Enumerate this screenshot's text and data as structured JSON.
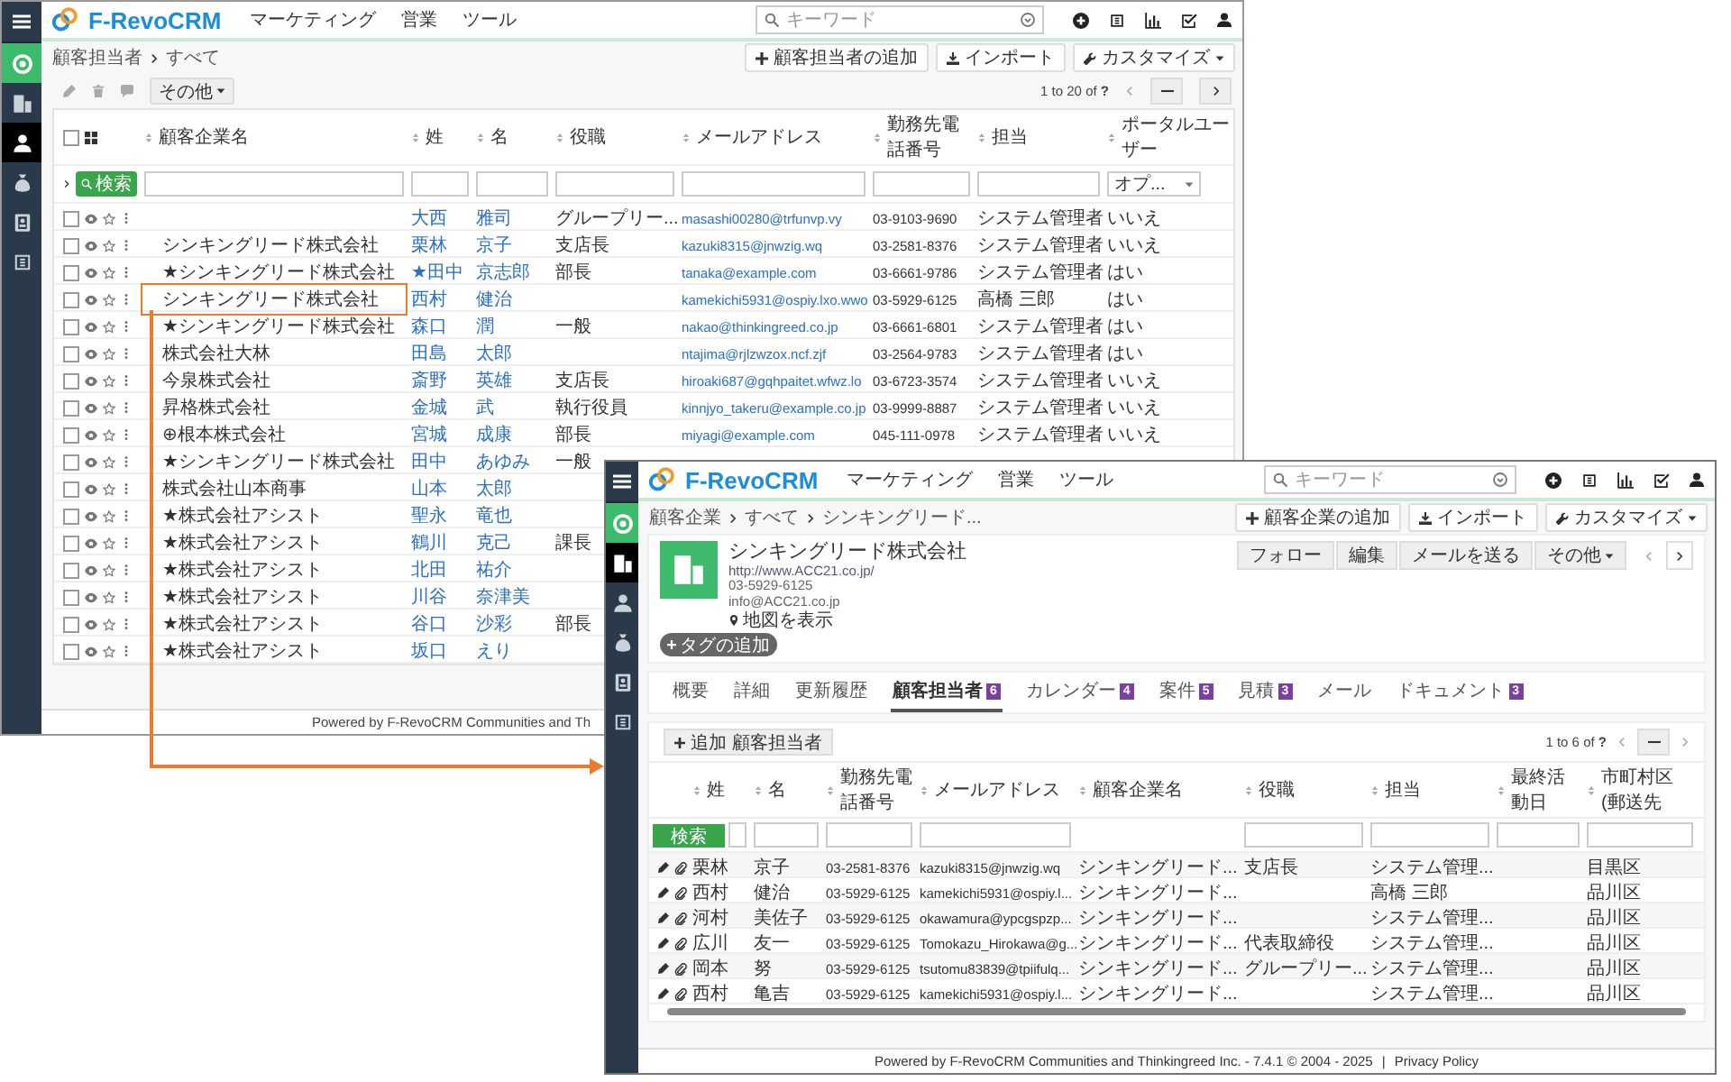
{
  "back_window": {
    "header": {
      "logo": "F-RevoCRM",
      "menus": [
        "マーケティング",
        "営業",
        "ツール"
      ],
      "search_placeholder": "キーワード"
    },
    "sidebar": [
      {
        "selected": false
      },
      {
        "selected": false
      },
      {
        "selected": true
      },
      {
        "selected": false
      },
      {
        "selected": false
      },
      {
        "selected": false
      }
    ],
    "breadcrumb": [
      "顧客担当者",
      "すべて"
    ],
    "actions": [
      "顧客担当者の追加",
      "インポート",
      "カスタマイズ"
    ],
    "toolbar": {
      "more": "その他",
      "pagination": "1 to 20  of **?**"
    },
    "table": {
      "select_all_checked": false,
      "columns": [
        "顧客企業名",
        "姓",
        "名",
        "役職",
        "メールアドレス",
        "勤務先電話番号",
        "担当",
        "ポータルユーザー"
      ],
      "search_button": "検索",
      "portal_filter": "オプ...",
      "rows": [
        {
          "checked": false,
          "highlighted": false,
          "last": "大西",
          "first": "雅司",
          "title": "グループリー...",
          "email": "masashi00280@trfunvp.vy",
          "phone": "03-9103-9690",
          "owner": "システム管理者",
          "portal": "いいえ"
        },
        {
          "checked": false,
          "highlighted": false,
          "company": "シンキングリード株式会社",
          "last": "栗林",
          "first": "京子",
          "title": "支店長",
          "email": "kazuki8315@jnwzig.wq",
          "phone": "03-2581-8376",
          "owner": "システム管理者",
          "portal": "いいえ"
        },
        {
          "checked": false,
          "highlighted": false,
          "company": "★シンキングリード株式会社",
          "last": "★田中",
          "first": "京志郎",
          "title": "部長",
          "email": "tanaka@example.com",
          "phone": "03-6661-9786",
          "owner": "システム管理者",
          "portal": "はい"
        },
        {
          "checked": false,
          "highlighted": true,
          "company": "シンキングリード株式会社",
          "last": "西村",
          "first": "健治",
          "email": "kamekichi5931@ospiy.lxo.wwo",
          "phone": "03-5929-6125",
          "owner": "高橋 三郎",
          "portal": "はい"
        },
        {
          "checked": false,
          "highlighted": false,
          "company": "★シンキングリード株式会社",
          "last": "森口",
          "first": "潤",
          "title": "一般",
          "email": "nakao@thinkingreed.co.jp",
          "phone": "03-6661-6801",
          "owner": "システム管理者",
          "portal": "はい"
        },
        {
          "checked": false,
          "highlighted": false,
          "company": "株式会社大林",
          "last": "田島",
          "first": "太郎",
          "email": "ntajima@rjlzwzox.ncf.zjf",
          "phone": "03-2564-9783",
          "owner": "システム管理者",
          "portal": "はい"
        },
        {
          "checked": false,
          "highlighted": false,
          "company": "今泉株式会社",
          "last": "斎野",
          "first": "英雄",
          "title": "支店長",
          "email": "hiroaki687@gqhpaitet.wfwz.lo",
          "phone": "03-6723-3574",
          "owner": "システム管理者",
          "portal": "いいえ"
        },
        {
          "checked": false,
          "highlighted": false,
          "company": "昇格株式会社",
          "last": "金城",
          "first": "武",
          "title": "執行役員",
          "email": "kinnjyo_takeru@example.co.jp",
          "phone": "03-9999-8887",
          "owner": "システム管理者",
          "portal": "いいえ"
        },
        {
          "checked": false,
          "highlighted": false,
          "company": "⊕根本株式会社",
          "last": "宮城",
          "first": "成康",
          "title": "部長",
          "email": "miyagi@example.com",
          "phone": "045-111-0978",
          "owner": "システム管理者",
          "portal": "いいえ"
        },
        {
          "checked": false,
          "highlighted": false,
          "company": "★シンキングリード株式会社",
          "last": "田中",
          "first": "あゆみ",
          "title": "一般"
        },
        {
          "checked": false,
          "highlighted": false,
          "company": "株式会社山本商事",
          "last": "山本",
          "first": "太郎"
        },
        {
          "checked": false,
          "highlighted": false,
          "company": "★株式会社アシスト",
          "last": "聖永",
          "first": "竜也"
        },
        {
          "checked": false,
          "highlighted": false,
          "company": "★株式会社アシスト",
          "last": "鶴川",
          "first": "克己",
          "title": "課長"
        },
        {
          "checked": false,
          "highlighted": false,
          "company": "★株式会社アシスト",
          "last": "北田",
          "first": "祐介"
        },
        {
          "checked": false,
          "highlighted": false,
          "company": "★株式会社アシスト",
          "last": "川谷",
          "first": "奈津美"
        },
        {
          "checked": false,
          "highlighted": false,
          "company": "★株式会社アシスト",
          "last": "谷口",
          "first": "沙彩",
          "title": "部長"
        },
        {
          "checked": false,
          "highlighted": false,
          "company": "★株式会社アシスト",
          "last": "坂口",
          "first": "えり"
        }
      ]
    },
    "footer": "Powered by F-RevoCRM Communities and Th"
  },
  "front_window": {
    "header": {
      "logo": "F-RevoCRM",
      "menus": [
        "マーケティング",
        "営業",
        "ツール"
      ],
      "search_placeholder": "キーワード"
    },
    "sidebar": [
      {
        "selected": false
      },
      {
        "selected": true
      },
      {
        "selected": false
      },
      {
        "selected": false
      },
      {
        "selected": false
      },
      {
        "selected": false
      }
    ],
    "breadcrumb": [
      "顧客企業",
      "すべて",
      "シンキングリード..."
    ],
    "actions": [
      "顧客企業の追加",
      "インポート",
      "カスタマイズ"
    ],
    "record": {
      "name": "シンキングリード株式会社",
      "website": "http://www.ACC21.co.jp/",
      "phone": "03-5929-6125",
      "email": "info@ACC21.co.jp",
      "map_link": "地図を表示",
      "tag_button": "タグの追加",
      "buttons": [
        "フォロー",
        "編集",
        "メールを送る",
        "その他"
      ]
    },
    "tabs": [
      {
        "label": "概要",
        "selected": false
      },
      {
        "label": "詳細",
        "selected": false
      },
      {
        "label": "更新履歴",
        "selected": false
      },
      {
        "label": "顧客担当者",
        "count": "6",
        "selected": true
      },
      {
        "label": "カレンダー",
        "count": "4",
        "selected": false
      },
      {
        "label": "案件",
        "count": "5",
        "selected": false
      },
      {
        "label": "見積",
        "count": "3",
        "selected": false
      },
      {
        "label": "メール",
        "selected": false
      },
      {
        "label": "ドキュメント",
        "count": "3",
        "selected": false
      }
    ],
    "related": {
      "add_button": "追加 顧客担当者",
      "pagination": "1 to 6  of **?**",
      "search_button": "検索",
      "columns": [
        {
          "label": "姓",
          "filterable": true
        },
        {
          "label": "名",
          "filterable": true
        },
        {
          "label": "勤務先電話番号",
          "filterable": true
        },
        {
          "label": "メールアドレス",
          "filterable": true
        },
        {
          "label": "顧客企業名",
          "filterable": false
        },
        {
          "label": "役職",
          "filterable": true
        },
        {
          "label": "担当",
          "filterable": true
        },
        {
          "label": "最終活動日",
          "filterable": true
        },
        {
          "label": "市町村区 (郵送先",
          "filterable": true
        }
      ],
      "rows": [
        {
          "last": "栗林",
          "first": "京子",
          "phone": "03-2581-8376",
          "email": "kazuki8315@jnwzig.wq",
          "company": "シンキングリード...",
          "title": "支店長",
          "owner": "システム管理...",
          "city": "目黒区"
        },
        {
          "last": "西村",
          "first": "健治",
          "phone": "03-5929-6125",
          "email": "kamekichi5931@ospiy.l...",
          "company": "シンキングリード...",
          "owner": "高橋 三郎",
          "city": "品川区"
        },
        {
          "last": "河村",
          "first": "美佐子",
          "phone": "03-5929-6125",
          "email": "okawamura@ypcgspzp...",
          "company": "シンキングリード...",
          "owner": "システム管理...",
          "city": "品川区"
        },
        {
          "last": "広川",
          "first": "友一",
          "phone": "03-5929-6125",
          "email": "Tomokazu_Hirokawa@g...",
          "company": "シンキングリード...",
          "title": "代表取締役",
          "owner": "システム管理...",
          "city": "品川区"
        },
        {
          "last": "岡本",
          "first": "努",
          "phone": "03-5929-6125",
          "email": "tsutomu83839@tpiifulq...",
          "company": "シンキングリード...",
          "title": "グループリー...",
          "owner": "システム管理...",
          "city": "品川区"
        },
        {
          "last": "西村",
          "first": "亀吉",
          "phone": "03-5929-6125",
          "email": "kamekichi5931@ospiy.l...",
          "company": "シンキングリード...",
          "owner": "システム管理...",
          "city": "品川区"
        }
      ]
    },
    "footer": {
      "text": "Powered by F-RevoCRM Communities and Thinkingreed Inc. - 7.4.1  © 2004 - 2025",
      "separator": "|",
      "link": "Privacy Policy"
    }
  }
}
